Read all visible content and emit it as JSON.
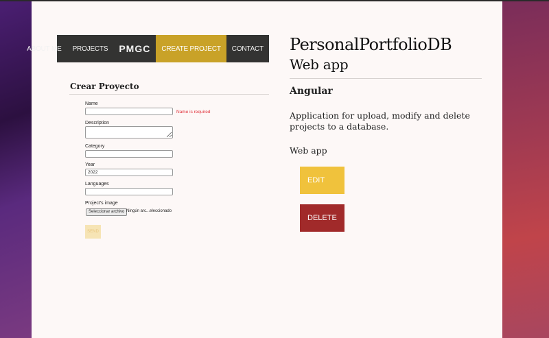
{
  "nav": {
    "about": "ABOUT ME",
    "projects": "PROJECTS",
    "logo": "PMGC",
    "create": "CREATE PROJECT",
    "contact": "CONTACT"
  },
  "form": {
    "title": "Crear Proyecto",
    "name_label": "Name",
    "name_value": "",
    "name_error": "Name is required",
    "description_label": "Description",
    "description_value": "",
    "category_label": "Category",
    "category_value": "",
    "year_label": "Year",
    "year_value": "2022",
    "languages_label": "Languages",
    "languages_value": "",
    "image_label": "Project's image",
    "file_button": "Seleccionar archivo",
    "file_status": "Ningún arc...eleccionado",
    "send_label": "SEND"
  },
  "detail": {
    "title": "PersonalPortfolioDB",
    "subtitle": "Web app",
    "technology": "Angular",
    "description": "Application for upload, modify and delete projects to a database.",
    "category": "Web app",
    "edit_label": "EDIT",
    "delete_label": "DELETE"
  },
  "colors": {
    "nav_bg": "#333332",
    "nav_active": "#c9a228",
    "edit": "#f0c23c",
    "delete": "#a12a2a",
    "error": "#e0303a"
  }
}
